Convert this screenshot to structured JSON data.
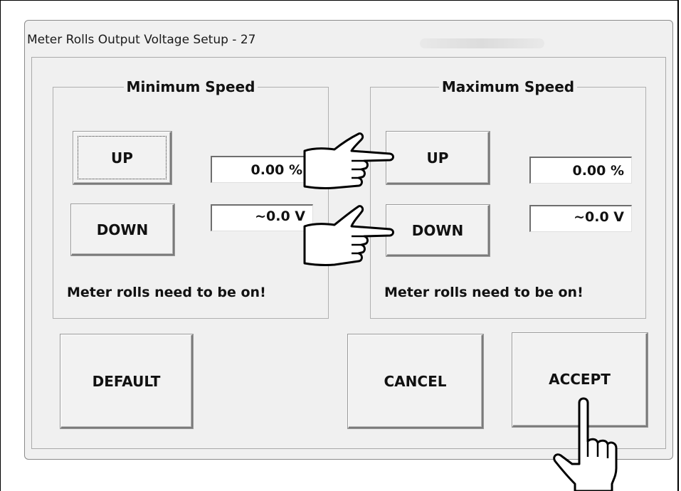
{
  "window": {
    "title": "Meter Rolls Output Voltage Setup - 27"
  },
  "min_speed": {
    "legend": "Minimum Speed",
    "up_label": "UP",
    "down_label": "DOWN",
    "percent_value": "0.00 %",
    "voltage_value": "~0.0 V",
    "note": "Meter rolls need to be on!"
  },
  "max_speed": {
    "legend": "Maximum Speed",
    "up_label": "UP",
    "down_label": "DOWN",
    "percent_value": "0.00 %",
    "voltage_value": "~0.0 V",
    "note": "Meter rolls need to be on!"
  },
  "buttons": {
    "default_label": "DEFAULT",
    "cancel_label": "CANCEL",
    "accept_label": "ACCEPT"
  },
  "icons": {
    "pointer_right_1": "pointing-hand-right-icon",
    "pointer_right_2": "pointing-hand-right-icon",
    "pointer_up": "pointing-hand-up-icon"
  }
}
